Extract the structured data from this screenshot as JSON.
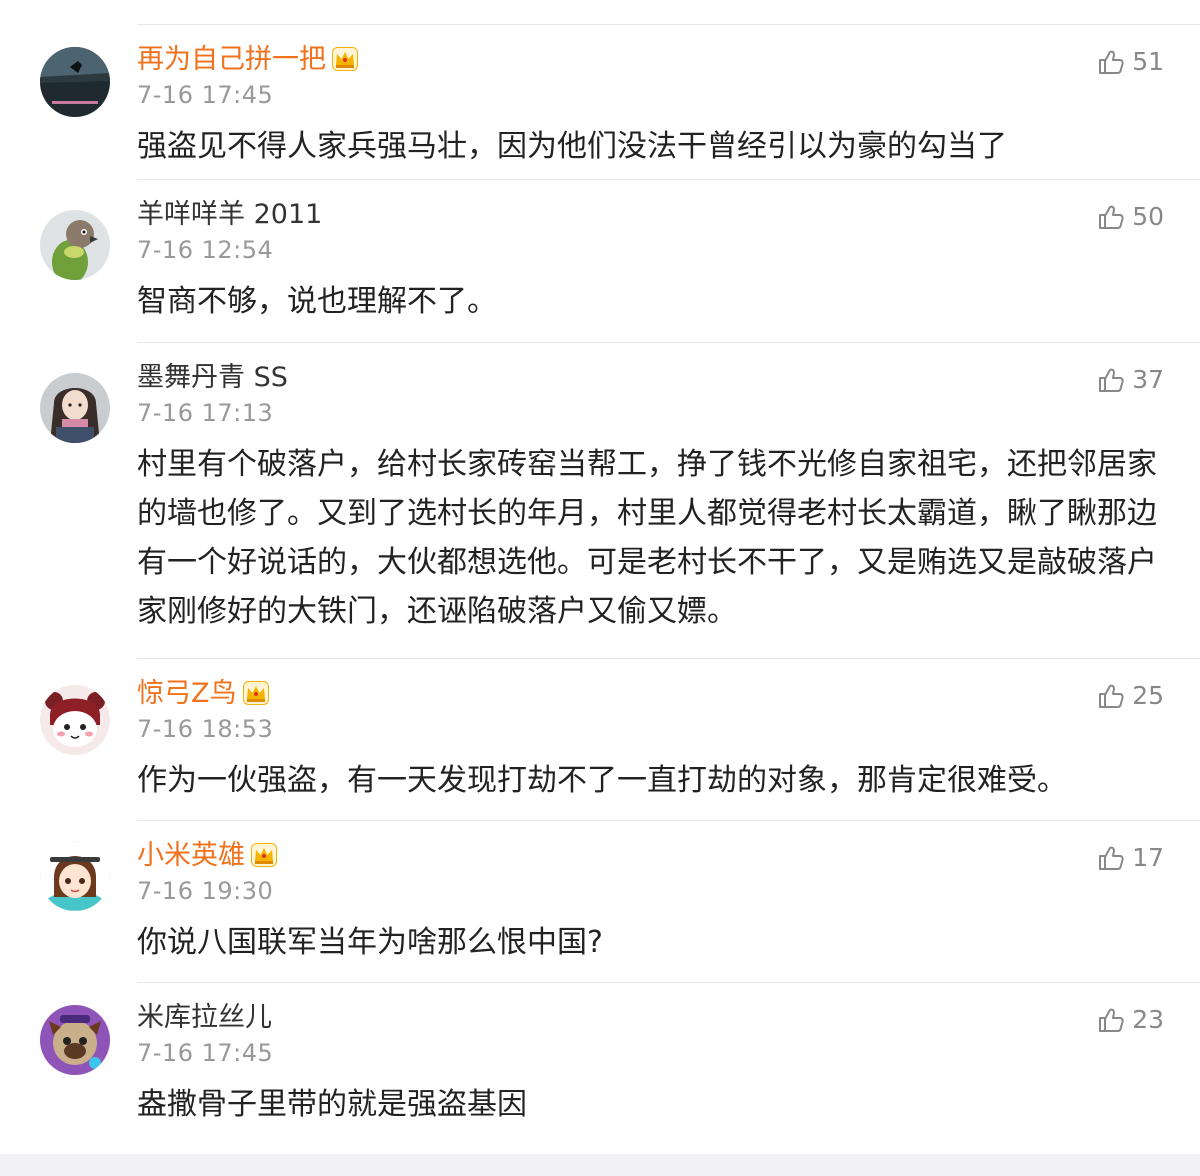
{
  "comments": [
    {
      "username": "再为自己拼一把",
      "vip": true,
      "time": "7-16 17:45",
      "text": "强盗见不得人家兵强马壮，因为他们没法干曾经引以为豪的勾当了",
      "likes": "51",
      "avatar": "dark-scene-avatar"
    },
    {
      "username": "羊咩咩羊 2011",
      "vip": false,
      "time": "7-16 12:54",
      "text": "智商不够，说也理解不了。",
      "likes": "50",
      "avatar": "parrot-avatar"
    },
    {
      "username": "墨舞丹青 SS",
      "vip": false,
      "time": "7-16 17:13",
      "text": "村里有个破落户，给村长家砖窑当帮工，挣了钱不光修自家祖宅，还把邻居家的墙也修了。又到了选村长的年月，村里人都觉得老村长太霸道，瞅了瞅那边有一个好说话的，大伙都想选他。可是老村长不干了，又是贿选又是敲破落户家刚修好的大铁门，还诬陷破落户又偷又嫖。",
      "likes": "37",
      "avatar": "anime-girl-avatar"
    },
    {
      "username": "惊弓Z鸟",
      "vip": true,
      "time": "7-16 18:53",
      "text": "作为一伙强盗，有一天发现打劫不了一直打劫的对象，那肯定很难受。",
      "likes": "25",
      "avatar": "cartoon-bear-avatar"
    },
    {
      "username": "小米英雄",
      "vip": true,
      "time": "7-16 19:30",
      "text": "你说八国联军当年为啥那么恨中国?",
      "likes": "17",
      "avatar": "cartoon-girl-avatar"
    },
    {
      "username": "米库拉丝儿",
      "vip": false,
      "time": "7-16 17:45",
      "text": "盎撒骨子里带的就是强盗基因",
      "likes": "23",
      "avatar": "purple-dog-avatar"
    }
  ],
  "colors": {
    "vip_name": "#f0721c",
    "name": "#333333",
    "time": "#999999",
    "text": "#222222",
    "likes": "#888888",
    "crown": "#f5b400"
  },
  "icons": {
    "like": "thumbs-up-icon",
    "vip": "crown-icon"
  }
}
